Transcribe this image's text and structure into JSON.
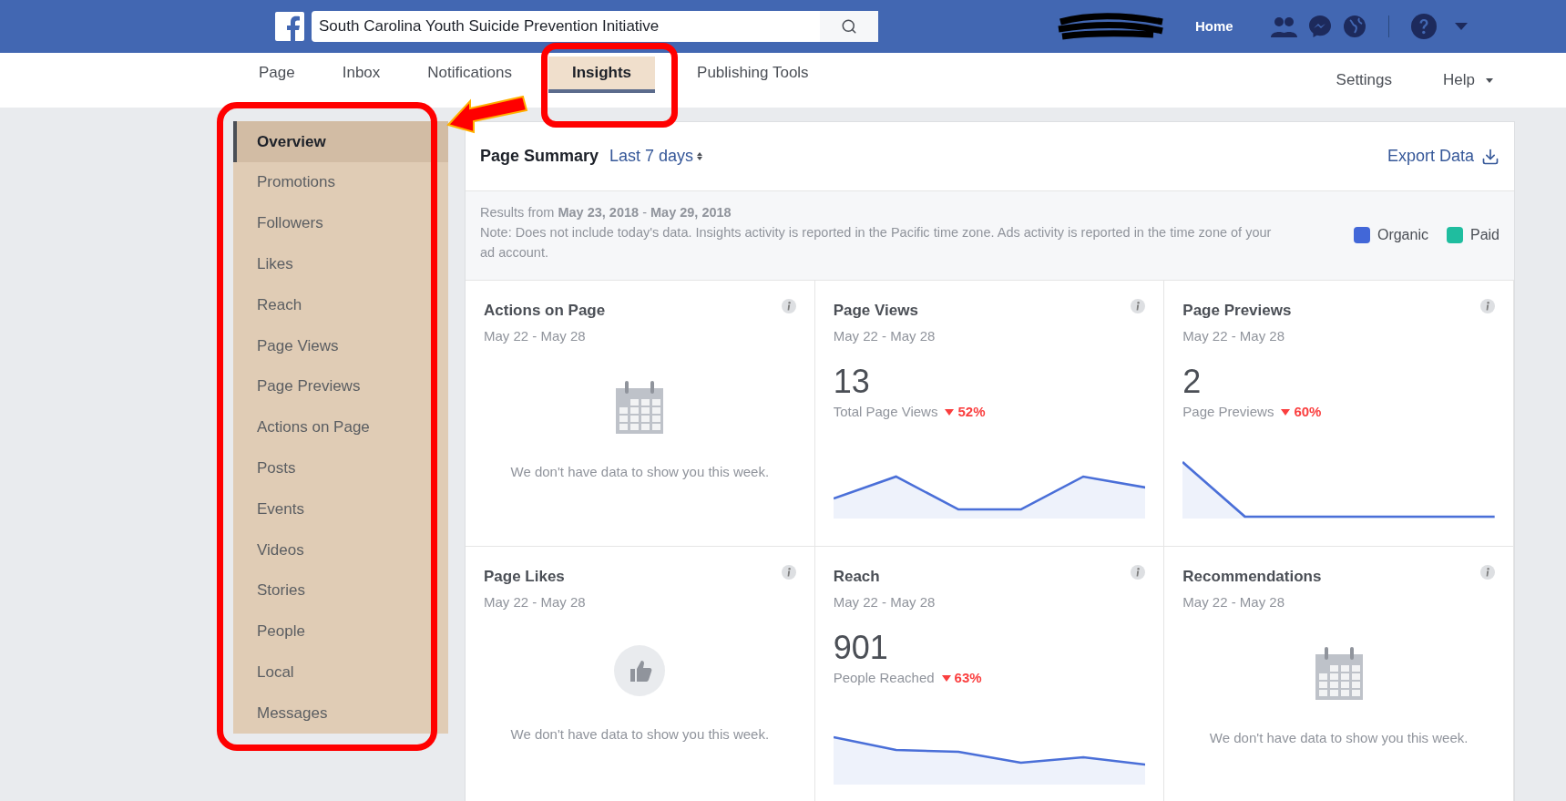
{
  "topbar": {
    "search_value": "South Carolina Youth Suicide Prevention Initiative",
    "home": "Home"
  },
  "nav": {
    "tabs": [
      {
        "label": "Page",
        "selected": false
      },
      {
        "label": "Inbox",
        "selected": false
      },
      {
        "label": "Notifications",
        "selected": false
      },
      {
        "label": "Insights",
        "selected": true
      },
      {
        "label": "Publishing Tools",
        "selected": false
      }
    ],
    "right": [
      {
        "label": "Settings",
        "dropdown": false
      },
      {
        "label": "Help",
        "dropdown": true
      }
    ]
  },
  "sidebar": {
    "items": [
      {
        "label": "Overview",
        "selected": true
      },
      {
        "label": "Promotions",
        "selected": false
      },
      {
        "label": "Followers",
        "selected": false
      },
      {
        "label": "Likes",
        "selected": false
      },
      {
        "label": "Reach",
        "selected": false
      },
      {
        "label": "Page Views",
        "selected": false
      },
      {
        "label": "Page Previews",
        "selected": false
      },
      {
        "label": "Actions on Page",
        "selected": false
      },
      {
        "label": "Posts",
        "selected": false
      },
      {
        "label": "Events",
        "selected": false
      },
      {
        "label": "Videos",
        "selected": false
      },
      {
        "label": "Stories",
        "selected": false
      },
      {
        "label": "People",
        "selected": false
      },
      {
        "label": "Local",
        "selected": false
      },
      {
        "label": "Messages",
        "selected": false
      }
    ]
  },
  "summary": {
    "title": "Page Summary",
    "range": "Last 7 days",
    "export": "Export Data",
    "results": "Results from **May 23, 2018** - **May 29, 2018**",
    "note": "Note: Does not include today's data. Insights activity is reported in the Pacific time zone. Ads activity is reported in the time zone of your ad account.",
    "legend": [
      {
        "label": "Organic",
        "color": "#4267d8"
      },
      {
        "label": "Paid",
        "color": "#1fbd9f"
      }
    ]
  },
  "cards": [
    {
      "kind": "calendar",
      "title": "Actions on Page",
      "dates": "May 22 - May 28",
      "message": "We don't have data to show you this week."
    },
    {
      "kind": "metric",
      "title": "Page Views",
      "dates": "May 22 - May 28",
      "value": "13",
      "label": "Total Page Views",
      "change": "52%"
    },
    {
      "kind": "metric",
      "title": "Page Previews",
      "dates": "May 22 - May 28",
      "value": "2",
      "label": "Page Previews",
      "change": "60%"
    },
    {
      "kind": "like",
      "title": "Page Likes",
      "dates": "May 22 - May 28",
      "message": "We don't have data to show you this week."
    },
    {
      "kind": "metric",
      "title": "Reach",
      "dates": "May 22 - May 28",
      "value": "901",
      "label": "People Reached",
      "change": "63%"
    },
    {
      "kind": "calendar",
      "title": "Recommendations",
      "dates": "May 22 - May 28",
      "message": "We don't have data to show you this week."
    }
  ]
}
